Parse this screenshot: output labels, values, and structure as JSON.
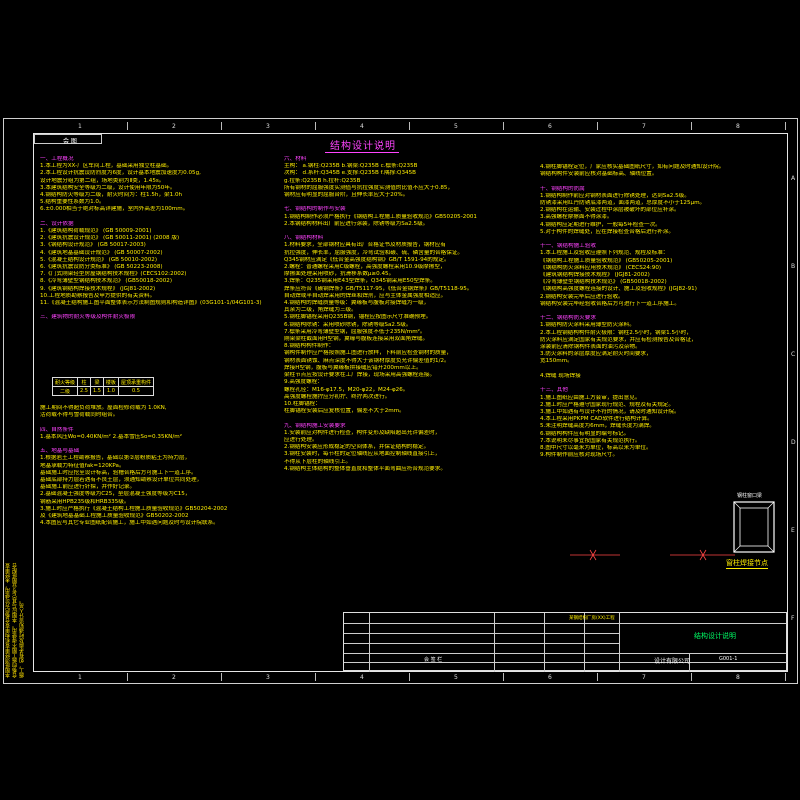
{
  "title": "结构设计说明",
  "header_label": "会 图",
  "ruler_top": [
    "1",
    "2",
    "3",
    "4",
    "5",
    "6",
    "7",
    "8"
  ],
  "ruler_side": [
    "A",
    "B",
    "C",
    "D",
    "E",
    "F"
  ],
  "binder_text": [
    "本图纸须经审查机构审查合格后方可使用，未经审查",
    "合格的施工图不得使用。本图应与其它专业图纸配合",
    "施工，如有矛盾及时通知设计人员。"
  ],
  "col1": [
    {
      "t": "一、工程概况",
      "c": "h"
    },
    {
      "t": "1.本工程为XX-厂区车间工程，基础采用独立柱基础。",
      "c": "y"
    },
    {
      "t": "2.本工程设计抗震设防烈度为6度，设计基本地震加速度为0.05g,",
      "c": "y"
    },
    {
      "t": "  设计地震分组为第二组，场地类别为Ⅱ类，1.45s。",
      "c": "y"
    },
    {
      "t": "3.本建筑结构安全等级为二级，设计使用年限为50年。",
      "c": "y"
    },
    {
      "t": "4.钢结构防火等级为二级，耐火时间为：柱1.5h，梁1.0h",
      "c": "y"
    },
    {
      "t": "5.结构重要性系数为1.0。",
      "c": "y"
    },
    {
      "t": "6.±0.000相当于绝对标高详建施，室内外高差为100mm。",
      "c": "y"
    },
    {
      "t": "",
      "c": "y"
    },
    {
      "t": "二、设计依据",
      "c": "h"
    },
    {
      "t": "1.《建筑结构荷载规范》          (GB 50009-2001)",
      "c": "y"
    },
    {
      "t": "2.《建筑抗震设计规范》          (GB 50011-2001)    (2008 版)",
      "c": "y"
    },
    {
      "t": "3.《钢结构设计规范》            (GB 50017-2003)",
      "c": "y"
    },
    {
      "t": "4.《建筑地基基础设计规范》      (GB 50007-2002)",
      "c": "y"
    },
    {
      "t": "5.《混凝土结构设计规范》        (GB 50010-2002)",
      "c": "y"
    },
    {
      "t": "6.《建筑抗震设防分类标准》      (GB 50223-2008)",
      "c": "y"
    },
    {
      "t": "7.《门式刚架轻型房屋钢结构技术规程》(CECS102:2002)",
      "c": "y"
    },
    {
      "t": "8.《冷弯薄壁型钢结构技术规范》  (GB50018-2002)",
      "c": "y"
    },
    {
      "t": "9.《建筑钢结构焊接技术规程》    (JGJ81-2002)",
      "c": "y"
    },
    {
      "t": "10.工程地质勘察报告及甲方提供的有关资料。",
      "c": "y"
    },
    {
      "t": "11.《混凝土结构施工图平面整体表示方法制图规则和构造详图》(03G101-1/04G101-3)",
      "c": "y"
    },
    {
      "t": "",
      "c": "y"
    },
    {
      "t": "三、建筑物的耐火等级及构件耐火极限",
      "c": "h"
    }
  ],
  "fire_table": {
    "headers": [
      "耐火等级",
      "柱",
      "梁",
      "楼板",
      "屋顶承重构件"
    ],
    "rows": [
      [
        "二级",
        "2.5",
        "1.5",
        "1.0",
        "0.5"
      ]
    ]
  },
  "col1b": [
    {
      "t": "施工期间不得超负荷堆放。屋面检修荷载为 1.0KN,",
      "c": "y"
    },
    {
      "t": "活荷载不得与雪荷载同时组合。",
      "c": "y"
    },
    {
      "t": "",
      "c": "y"
    },
    {
      "t": "四、自然条件",
      "c": "h"
    },
    {
      "t": "1.基本风压Wo=0.40KN/m²     2.基本雪压So=0.35KN/m²",
      "c": "y"
    },
    {
      "t": "",
      "c": "y"
    },
    {
      "t": "五、地基与基础",
      "c": "h"
    },
    {
      "t": "1.根据岩土工程勘察报告，基础以第②层粉质粘土为持力层，",
      "c": "y"
    },
    {
      "t": "  地基承载力特征值fak=120KPa。",
      "c": "y"
    },
    {
      "t": "  基础施工时应挖至设计标高，验槽合格后方可施工下一道工序。",
      "c": "y"
    },
    {
      "t": "  基础底部持力层若遇有不良土层，须通知勘察设计单位共同处理，",
      "c": "y"
    },
    {
      "t": "  基础施工前应进行钎探，并作好记录。",
      "c": "y"
    },
    {
      "t": "2.基础混凝土强度等级为C25，垫层混凝土强度等级为C15，",
      "c": "y"
    },
    {
      "t": "  钢筋采用HPB235级和HRB335级。",
      "c": "y"
    },
    {
      "t": "3.施工时应严格执行《混凝土结构工程施工质量验收规范》GB50204-2002",
      "c": "y"
    },
    {
      "t": "  及《建筑地基基础工程施工质量验收规范》GB50202-2002",
      "c": "y"
    },
    {
      "t": "4.本图应与其它专业图纸配合施工，施工中如遇问题及时与设计院联系。",
      "c": "y"
    }
  ],
  "col2": [
    {
      "t": "六、材料",
      "c": "h"
    },
    {
      "t": "主构：  a.钢柱:Q235B       b.钢梁:Q235B       c.檩条:Q235B",
      "c": "y"
    },
    {
      "t": "次构：  d.系杆:Q345B       e.支撑:Q235B       f.隅撑:Q345B",
      "c": "y"
    },
    {
      "t": "        g.拉条:Q235B       h.拉杆:Q235B",
      "c": "y"
    },
    {
      "t": "  所有钢材的屈服强度实测值与抗拉强度实测值的比值不应大于0.85，",
      "c": "y"
    },
    {
      "t": "  钢材应有明显的屈服台阶，且伸长率应大于20%。",
      "c": "y"
    },
    {
      "t": "",
      "c": "y"
    },
    {
      "t": "七、钢结构的制作与安装",
      "c": "h"
    },
    {
      "t": "1.钢结构制作必须严格执行《钢结构工程施工质量验收规范》GB50205-2001",
      "c": "y"
    },
    {
      "t": "2.本钢结构材料出厂前应进行涂装，除锈等级为Sa2.5级。",
      "c": "y"
    },
    {
      "t": "",
      "c": "y"
    },
    {
      "t": "八、钢结构材料",
      "c": "h"
    },
    {
      "t": "1.材料要求，全部钢材应具有出厂合格证书及材质报告，钢材应有",
      "c": "y"
    },
    {
      "t": "  抗拉强度，伸长率，屈服强度，冷弯试验和碳、硫、磷含量的合格保证。",
      "c": "y"
    },
    {
      "t": "  Q345钢材应满足《低合金高强度结构钢》GB/T 1591-94的规定。",
      "c": "y"
    },
    {
      "t": "2.螺栓：普通螺栓采用C级螺栓，高强度螺栓采用10.9级摩擦型，",
      "c": "y"
    },
    {
      "t": "  摩擦面处理采用喷砂，抗滑移系数μ≥0.45。",
      "c": "y"
    },
    {
      "t": "3.焊条：Q235钢采用E43型焊条，Q345钢采用E50型焊条。",
      "c": "y"
    },
    {
      "t": "  焊条应符合《碳钢焊条》GB/T5117-95，《低合金钢焊条》GB/T5118-95。",
      "c": "y"
    },
    {
      "t": "  自动焊或半自动焊采用的焊丝和焊剂，应与主体金属强度相适应。",
      "c": "y"
    },
    {
      "t": "4.钢结构的焊缝质量等级：翼缘板与腹板对接焊缝为一级，",
      "c": "y"
    },
    {
      "t": "  其余为二级，角焊缝为三级。",
      "c": "y"
    },
    {
      "t": "5.钢柱脚锚栓采用Q235B钢，锚栓应按图示尺寸准确预埋。",
      "c": "y"
    },
    {
      "t": "6.钢结构除锈：采用喷砂除锈，除锈等级Sa2.5级。",
      "c": "y"
    },
    {
      "t": "7.檩条采用冷弯薄壁型钢，屈服强度不低于235N/mm²。",
      "c": "y"
    },
    {
      "t": "  刚架梁柱截面用H型钢，翼缘与腹板连接采用双面角焊缝。",
      "c": "y"
    },
    {
      "t": "8.钢结构构件制作：",
      "c": "y"
    },
    {
      "t": "  钢构件制作应严格按照施工图进行放样，下料前应检查钢材的质量，",
      "c": "y"
    },
    {
      "t": "  钢材表面锈蚀、麻点深度不得大于该钢材厚度负允许偏差值的1/2。",
      "c": "y"
    },
    {
      "t": "  焊接H型钢，腹板与翼缘板拼接缝应错开200mm以上。",
      "c": "y"
    },
    {
      "t": "  梁柱节点应按设计要求在工厂焊接，现场采用高强螺栓连接。",
      "c": "y"
    },
    {
      "t": "9.高强度螺栓：",
      "c": "y"
    },
    {
      "t": "  螺栓孔径：M16-φ17.5，M20-φ22，M24-φ26。",
      "c": "y"
    },
    {
      "t": "  高强度螺栓施拧应分初拧、终拧两次进行。",
      "c": "y"
    },
    {
      "t": "10.柱脚锚栓：",
      "c": "y"
    },
    {
      "t": "  柱脚锚栓安装后应复核位置，偏差不大于2mm。",
      "c": "y"
    },
    {
      "t": "",
      "c": "y"
    },
    {
      "t": "九、钢结构施工安装要求",
      "c": "h"
    },
    {
      "t": "1.安装前应对构件进行检查，构件变形及缺陷超出允许偏差时，",
      "c": "y"
    },
    {
      "t": "  应进行处理。",
      "c": "y"
    },
    {
      "t": "2.钢结构安装应形成稳定的空间体系，并保证结构的稳定。",
      "c": "y"
    },
    {
      "t": "3.钢柱安装时，每节柱的定位轴线应从地面控制轴线直接引上，",
      "c": "y"
    },
    {
      "t": "  不得从下层柱的轴线引上。",
      "c": "y"
    },
    {
      "t": "4.钢结构主体结构的整体垂直度和整体平面弯曲应符合规范要求。",
      "c": "y"
    }
  ],
  "col3": [
    {
      "t": "4.钢柱脚锚栓定位，厂家应核实基础图纸尺寸，如有问题及时通知设计院。",
      "c": "y"
    },
    {
      "t": "  钢结构构件安装前应核对基础标高、轴线位置。",
      "c": "y"
    },
    {
      "t": "",
      "c": "y"
    },
    {
      "t": "十、钢结构的防腐",
      "c": "h"
    },
    {
      "t": "1.钢结构制作前应对钢材表面进行除锈处理，达到Sa2.5级。",
      "c": "y"
    },
    {
      "t": "  防锈漆采用红丹防锈底漆两道，面漆两道，总厚度不小于125μm。",
      "c": "y"
    },
    {
      "t": "2.钢结构在运输、安装过程中涂层被破坏的部位应补涂。",
      "c": "y"
    },
    {
      "t": "3.高强螺栓摩擦面不得涂漆。",
      "c": "y"
    },
    {
      "t": "4.钢结构应定期进行维护，一般每5年检查一次。",
      "c": "y"
    },
    {
      "t": "5.对于构件的焊缝处，应在焊接检查合格后进行补涂。",
      "c": "y"
    },
    {
      "t": "",
      "c": "y"
    },
    {
      "t": "十一、钢结构施工验收",
      "c": "h"
    },
    {
      "t": "1.本工程施工及验收应遵照下列规范、规程及标准：",
      "c": "y"
    },
    {
      "t": "  《钢结构工程施工质量验收规范》   (GB50205-2001)",
      "c": "y"
    },
    {
      "t": "  《钢结构防火涂料应用技术规范》   (CECS24:90)",
      "c": "y"
    },
    {
      "t": "  《建筑钢结构焊接技术规程》       (JGJ81-2002)",
      "c": "y"
    },
    {
      "t": "  《冷弯薄壁型钢结构技术规范》     (GB50018-2002)",
      "c": "y"
    },
    {
      "t": "  《钢结构高强度螺栓连接的设计、施工及验收规程》(JGJ82-91)",
      "c": "y"
    },
    {
      "t": "2.钢结构安装完毕后应进行验收。",
      "c": "y"
    },
    {
      "t": "  钢结构安装完毕经验收合格后方可进行下一道工序施工。",
      "c": "y"
    },
    {
      "t": "",
      "c": "y"
    },
    {
      "t": "十二、钢结构防火要求",
      "c": "h"
    },
    {
      "t": "1.钢结构防火涂料采用薄型防火涂料。",
      "c": "y"
    },
    {
      "t": "2.本工程钢结构构件耐火极限：钢柱2.5小时，钢梁1.5小时，",
      "c": "y"
    },
    {
      "t": "  防火涂料应满足国家有关规范要求，并应有检测报告及合格证，",
      "c": "y"
    },
    {
      "t": "  涂装前应清除钢构件表面的油污及杂物。",
      "c": "y"
    },
    {
      "t": "3.防火涂料的涂层厚度应满足耐火时间要求，",
      "c": "y"
    },
    {
      "t": "  宽150mm。",
      "c": "y"
    },
    {
      "t": "",
      "c": "y"
    },
    {
      "t": "4.焊缝            现场焊接",
      "c": "y"
    },
    {
      "t": "",
      "c": "y"
    },
    {
      "t": "十三、其他",
      "c": "h"
    },
    {
      "t": "1.施工图纸应由施工方会审，提出意见。",
      "c": "y"
    },
    {
      "t": "2.施工时应严格遵守国家现行规范、规程及有关规定。",
      "c": "y"
    },
    {
      "t": "3.施工中如遇有与设计不符的情况，请及时通知设计院。",
      "c": "y"
    },
    {
      "t": "4.本工程采用PKPM CAD软件进行结构计算。",
      "c": "y"
    },
    {
      "t": "5.未注明焊缝高度为6mm，焊缝长度为满焊。",
      "c": "y"
    },
    {
      "t": "6.钢结构构件应有明显的编号标记。",
      "c": "y"
    },
    {
      "t": "7.本说明未尽事宜按国家有关规范执行。",
      "c": "y"
    },
    {
      "t": "8.图中尺寸以毫米为单位，标高以米为单位。",
      "c": "y"
    },
    {
      "t": "9.构件制作前应核对现场尺寸。",
      "c": "y"
    }
  ],
  "detail_label": "窗柱焊接节点",
  "detail_top": "钢柱窗口梁",
  "titleblock": {
    "sheet_title": "结构设计说明",
    "drawing_no": "G001-1",
    "company": "设计有限公司",
    "project": "某钢结构厂房(XX)工程",
    "left_label": "会 签 栏"
  },
  "colors": {
    "heading": "#ff44ff",
    "body": "#ffee00",
    "line": "#dddddd",
    "bg": "#000000"
  }
}
